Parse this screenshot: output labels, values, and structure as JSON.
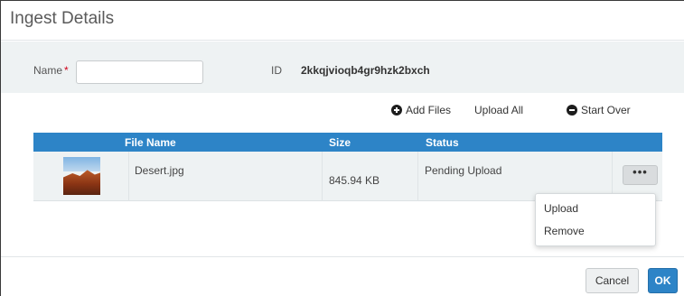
{
  "dialog": {
    "title": "Ingest Details"
  },
  "form": {
    "name_label": "Name",
    "required_marker": "*",
    "name_value": "",
    "id_label": "ID",
    "id_value": "2kkqjvioqb4gr9hzk2bxch"
  },
  "actions": {
    "add_files": "Add Files",
    "upload_all": "Upload All",
    "start_over": "Start Over",
    "add_files_icon": "plus-circle-icon",
    "start_over_icon": "minus-circle-icon"
  },
  "table": {
    "columns": [
      "File Name",
      "Size",
      "Status"
    ],
    "rows": [
      {
        "thumbnail": "desert-thumbnail",
        "file_name": "Desert.jpg",
        "size": "845.94 KB",
        "status": "Pending Upload",
        "more_label": "•••"
      }
    ],
    "header_color": "#2d84c7"
  },
  "row_menu": {
    "items": [
      "Upload",
      "Remove"
    ]
  },
  "footer": {
    "cancel_label": "Cancel",
    "ok_label": "OK",
    "ok_color": "#2d84c7"
  }
}
